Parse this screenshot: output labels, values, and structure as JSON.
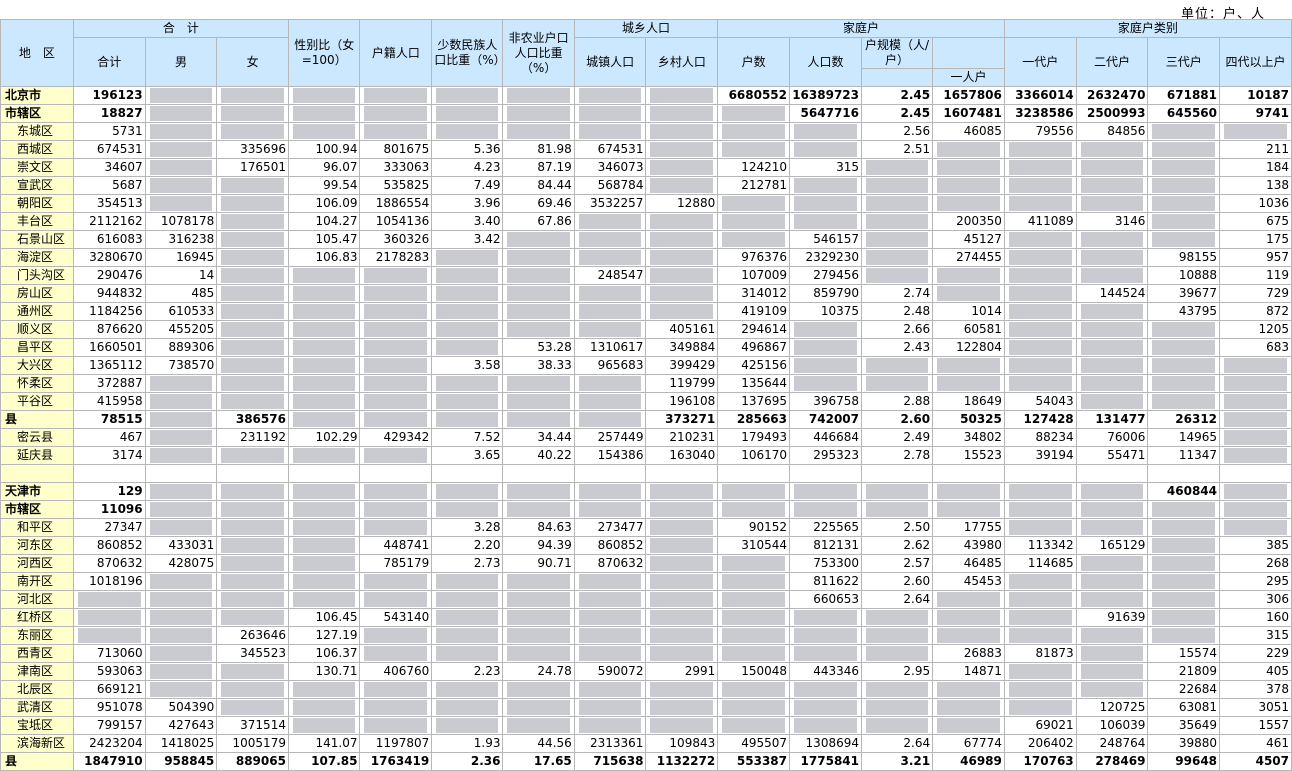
{
  "unit_label": "单位：户、人",
  "headers": {
    "region": "地　区",
    "total_group": "合　计",
    "total": "合计",
    "male": "男",
    "female": "女",
    "sex_ratio": "性别比（女=100）",
    "hukou": "户籍人口",
    "minority": "少数民族人口比重（%）",
    "nonagri": "非农业户口人口比重（%）",
    "urban_rural_group": "城乡人口",
    "urban": "城镇人口",
    "rural": "乡村人口",
    "household_group": "家庭户",
    "households": "户数",
    "hh_pop": "人口数",
    "hh_size": "户规模（人/户）",
    "type_group": "家庭户类别",
    "one_person": "一人户",
    "gen1": "一代户",
    "gen2": "二代户",
    "gen3": "三代户",
    "gen4": "四代以上户"
  },
  "rows": [
    {
      "region": "北京市",
      "bold": true,
      "sub": false,
      "c": [
        "196123",
        "",
        "",
        "",
        "",
        "",
        "",
        "",
        "",
        "6680552",
        "16389723",
        "2.45",
        "1657806",
        "3366014",
        "2632470",
        "671881",
        "10187"
      ]
    },
    {
      "region": "市辖区",
      "bold": true,
      "sub": false,
      "c": [
        "18827",
        "",
        "",
        "",
        "",
        "",
        "",
        "",
        "",
        "",
        "5647716",
        "2.45",
        "1607481",
        "3238586",
        "2500993",
        "645560",
        "9741"
      ]
    },
    {
      "region": "东城区",
      "bold": false,
      "sub": true,
      "c": [
        "5731",
        "",
        "",
        "",
        "",
        "",
        "",
        "",
        "",
        "",
        "",
        "2.56",
        "46085",
        "79556",
        "84856",
        "",
        ""
      ]
    },
    {
      "region": "西城区",
      "bold": false,
      "sub": true,
      "c": [
        "674531",
        "",
        "335696",
        "100.94",
        "801675",
        "5.36",
        "81.98",
        "674531",
        "",
        "",
        "",
        "2.51",
        "",
        "",
        "",
        "",
        "211"
      ]
    },
    {
      "region": "崇文区",
      "bold": false,
      "sub": true,
      "c": [
        "34607",
        "",
        "176501",
        "96.07",
        "333063",
        "4.23",
        "87.19",
        "346073",
        "",
        "124210",
        "315",
        "",
        "",
        "",
        "",
        "",
        "184"
      ]
    },
    {
      "region": "宣武区",
      "bold": false,
      "sub": true,
      "c": [
        "5687",
        "",
        "",
        "99.54",
        "535825",
        "7.49",
        "84.44",
        "568784",
        "",
        "212781",
        "",
        "",
        "",
        "",
        "",
        "",
        "138"
      ]
    },
    {
      "region": "朝阳区",
      "bold": false,
      "sub": true,
      "c": [
        "354513",
        "",
        "",
        "106.09",
        "1886554",
        "3.96",
        "69.46",
        "3532257",
        "12880",
        "",
        "",
        "",
        "",
        "",
        "",
        "",
        "1036"
      ]
    },
    {
      "region": "丰台区",
      "bold": false,
      "sub": true,
      "c": [
        "2112162",
        "1078178",
        "",
        "104.27",
        "1054136",
        "3.40",
        "67.86",
        "",
        "",
        "",
        "",
        "",
        "200350",
        "411089",
        "3146",
        "",
        "675"
      ]
    },
    {
      "region": "石景山区",
      "bold": false,
      "sub": true,
      "c": [
        "616083",
        "316238",
        "",
        "105.47",
        "360326",
        "3.42",
        "",
        "",
        "",
        "",
        "546157",
        "",
        "45127",
        "",
        "",
        "",
        "175"
      ]
    },
    {
      "region": "海淀区",
      "bold": false,
      "sub": true,
      "c": [
        "3280670",
        "16945",
        "",
        "106.83",
        "2178283",
        "",
        "",
        "",
        "",
        "976376",
        "2329230",
        "",
        "274455",
        "",
        "",
        "98155",
        "957"
      ]
    },
    {
      "region": "门头沟区",
      "bold": false,
      "sub": true,
      "c": [
        "290476",
        "14",
        "",
        "",
        "",
        "",
        "",
        "248547",
        "",
        "107009",
        "279456",
        "",
        "",
        "",
        "",
        "10888",
        "119"
      ]
    },
    {
      "region": "房山区",
      "bold": false,
      "sub": true,
      "c": [
        "944832",
        "485",
        "",
        "",
        "",
        "",
        "",
        "",
        "",
        "314012",
        "859790",
        "2.74",
        "",
        "",
        "144524",
        "39677",
        "729"
      ]
    },
    {
      "region": "通州区",
      "bold": false,
      "sub": true,
      "c": [
        "1184256",
        "610533",
        "",
        "",
        "",
        "",
        "",
        "",
        "",
        "419109",
        "10375",
        "2.48",
        "1014",
        "",
        "",
        "43795",
        "872"
      ]
    },
    {
      "region": "顺义区",
      "bold": false,
      "sub": true,
      "c": [
        "876620",
        "455205",
        "",
        "",
        "",
        "",
        "",
        "",
        "405161",
        "294614",
        "",
        "2.66",
        "60581",
        "",
        "",
        "",
        "1205"
      ]
    },
    {
      "region": "昌平区",
      "bold": false,
      "sub": true,
      "c": [
        "1660501",
        "889306",
        "",
        "",
        "",
        "",
        "53.28",
        "1310617",
        "349884",
        "496867",
        "",
        "2.43",
        "122804",
        "",
        "",
        "",
        "683"
      ]
    },
    {
      "region": "大兴区",
      "bold": false,
      "sub": true,
      "c": [
        "1365112",
        "738570",
        "",
        "",
        "",
        "3.58",
        "38.33",
        "965683",
        "399429",
        "425156",
        "",
        "",
        "",
        "",
        "",
        "",
        ""
      ]
    },
    {
      "region": "怀柔区",
      "bold": false,
      "sub": true,
      "c": [
        "372887",
        "",
        "",
        "",
        "",
        "",
        "",
        "",
        "119799",
        "135644",
        "",
        "",
        "",
        "",
        "",
        "",
        ""
      ]
    },
    {
      "region": "平谷区",
      "bold": false,
      "sub": true,
      "c": [
        "415958",
        "",
        "",
        "",
        "",
        "",
        "",
        "",
        "196108",
        "137695",
        "396758",
        "2.88",
        "18649",
        "54043",
        "",
        "",
        ""
      ]
    },
    {
      "region": "县",
      "bold": true,
      "sub": false,
      "c": [
        "78515",
        "",
        "386576",
        "",
        "",
        "",
        "",
        "",
        "373271",
        "285663",
        "742007",
        "2.60",
        "50325",
        "127428",
        "131477",
        "26312",
        ""
      ]
    },
    {
      "region": "密云县",
      "bold": false,
      "sub": true,
      "c": [
        "467",
        "",
        "231192",
        "102.29",
        "429342",
        "7.52",
        "34.44",
        "257449",
        "210231",
        "179493",
        "446684",
        "2.49",
        "34802",
        "88234",
        "76006",
        "14965",
        ""
      ]
    },
    {
      "region": "延庆县",
      "bold": false,
      "sub": true,
      "c": [
        "3174",
        "",
        "",
        "",
        "",
        "3.65",
        "40.22",
        "154386",
        "163040",
        "106170",
        "295323",
        "2.78",
        "15523",
        "39194",
        "55471",
        "11347",
        ""
      ]
    },
    {
      "region": "",
      "bold": false,
      "sub": false,
      "c": [
        "",
        "",
        "",
        "",
        "",
        "",
        "",
        "",
        "",
        "",
        "",
        "",
        "",
        "",
        "",
        "",
        ""
      ]
    },
    {
      "region": "天津市",
      "bold": true,
      "sub": false,
      "c": [
        "129",
        "",
        "",
        "",
        "",
        "",
        "",
        "",
        "",
        "",
        "",
        "",
        "",
        "",
        "",
        "460844",
        ""
      ]
    },
    {
      "region": "市辖区",
      "bold": true,
      "sub": false,
      "c": [
        "11096",
        "",
        "",
        "",
        "",
        "",
        "",
        "",
        "",
        "",
        "",
        "",
        "",
        "",
        "",
        "",
        ""
      ]
    },
    {
      "region": "和平区",
      "bold": false,
      "sub": true,
      "c": [
        "27347",
        "",
        "",
        "",
        "",
        "3.28",
        "84.63",
        "273477",
        "",
        "90152",
        "225565",
        "2.50",
        "17755",
        "",
        "",
        "",
        ""
      ]
    },
    {
      "region": "河东区",
      "bold": false,
      "sub": true,
      "c": [
        "860852",
        "433031",
        "",
        "",
        "448741",
        "2.20",
        "94.39",
        "860852",
        "",
        "310544",
        "812131",
        "2.62",
        "43980",
        "113342",
        "165129",
        "",
        "385"
      ]
    },
    {
      "region": "河西区",
      "bold": false,
      "sub": true,
      "c": [
        "870632",
        "428075",
        "",
        "",
        "785179",
        "2.73",
        "90.71",
        "870632",
        "",
        "",
        "753300",
        "2.57",
        "46485",
        "114685",
        "",
        "",
        "268"
      ]
    },
    {
      "region": "南开区",
      "bold": false,
      "sub": true,
      "c": [
        "1018196",
        "",
        "",
        "",
        "",
        "",
        "",
        "",
        "",
        "",
        "811622",
        "2.60",
        "45453",
        "",
        "",
        "",
        "295"
      ]
    },
    {
      "region": "河北区",
      "bold": false,
      "sub": true,
      "c": [
        "",
        "",
        "",
        "",
        "",
        "",
        "",
        "",
        "",
        "",
        "660653",
        "2.64",
        "",
        "",
        "",
        "",
        "306"
      ]
    },
    {
      "region": "红桥区",
      "bold": false,
      "sub": true,
      "c": [
        "",
        "",
        "",
        "106.45",
        "543140",
        "",
        "",
        "",
        "",
        "",
        "",
        "",
        "",
        "",
        "91639",
        "",
        "160"
      ]
    },
    {
      "region": "东丽区",
      "bold": false,
      "sub": true,
      "c": [
        "",
        "",
        "263646",
        "127.19",
        "",
        "",
        "",
        "",
        "",
        "",
        "",
        "",
        "",
        "",
        "",
        "",
        "315"
      ]
    },
    {
      "region": "西青区",
      "bold": false,
      "sub": true,
      "c": [
        "713060",
        "",
        "345523",
        "106.37",
        "",
        "",
        "",
        "",
        "",
        "",
        "",
        "",
        "26883",
        "81873",
        "",
        "15574",
        "229"
      ]
    },
    {
      "region": "津南区",
      "bold": false,
      "sub": true,
      "c": [
        "593063",
        "",
        "",
        "130.71",
        "406760",
        "2.23",
        "24.78",
        "590072",
        "2991",
        "150048",
        "443346",
        "2.95",
        "14871",
        "",
        "",
        "21809",
        "405"
      ]
    },
    {
      "region": "北辰区",
      "bold": false,
      "sub": true,
      "c": [
        "669121",
        "",
        "",
        "",
        "",
        "",
        "",
        "",
        "",
        "",
        "",
        "",
        "",
        "",
        "",
        "22684",
        "378"
      ]
    },
    {
      "region": "武清区",
      "bold": false,
      "sub": true,
      "c": [
        "951078",
        "504390",
        "",
        "",
        "",
        "",
        "",
        "",
        "",
        "",
        "",
        "",
        "",
        "",
        "120725",
        "63081",
        "3051"
      ]
    },
    {
      "region": "宝坻区",
      "bold": false,
      "sub": true,
      "c": [
        "799157",
        "427643",
        "371514",
        "",
        "",
        "",
        "",
        "",
        "",
        "",
        "",
        "",
        "",
        "69021",
        "106039",
        "35649",
        "1557"
      ]
    },
    {
      "region": "滨海新区",
      "bold": false,
      "sub": true,
      "c": [
        "2423204",
        "1418025",
        "1005179",
        "141.07",
        "1197807",
        "1.93",
        "44.56",
        "2313361",
        "109843",
        "495507",
        "1308694",
        "2.64",
        "67774",
        "206402",
        "248764",
        "39880",
        "461"
      ]
    },
    {
      "region": "县",
      "bold": true,
      "sub": false,
      "c": [
        "1847910",
        "958845",
        "889065",
        "107.85",
        "1763419",
        "2.36",
        "17.65",
        "715638",
        "1132272",
        "553387",
        "1775841",
        "3.21",
        "46989",
        "170763",
        "278469",
        "99648",
        "4507"
      ]
    }
  ]
}
